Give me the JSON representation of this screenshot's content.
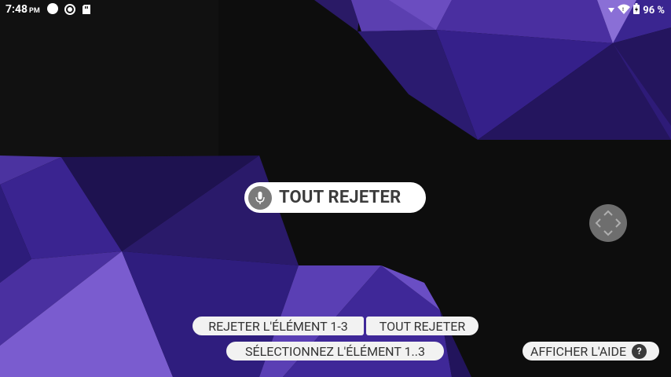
{
  "status_bar": {
    "time": "7:48",
    "ampm": "PM",
    "battery": "96 %",
    "icons": [
      "notification-dot-icon",
      "screen-record-icon",
      "sd-card-icon",
      "signal-icon",
      "wifi-icon",
      "battery-icon"
    ]
  },
  "voice": {
    "recognized_command": "TOUT REJETER",
    "icon": "microphone-icon"
  },
  "commands": {
    "dismiss_item": "REJETER L'ÉLÉMENT 1-3",
    "dismiss_all": "TOUT REJETER",
    "select_item": "SÉLECTIONNEZ L'ÉLÉMENT 1..3",
    "show_help": "AFFICHER L'AIDE",
    "help_badge": "?"
  },
  "colors": {
    "wallpaper_dark": "#0d0d0d",
    "wallpaper_purple": "#4a2fa0",
    "chip_bg": "#f2f2f2",
    "mic_bg": "#7a7a7a"
  }
}
